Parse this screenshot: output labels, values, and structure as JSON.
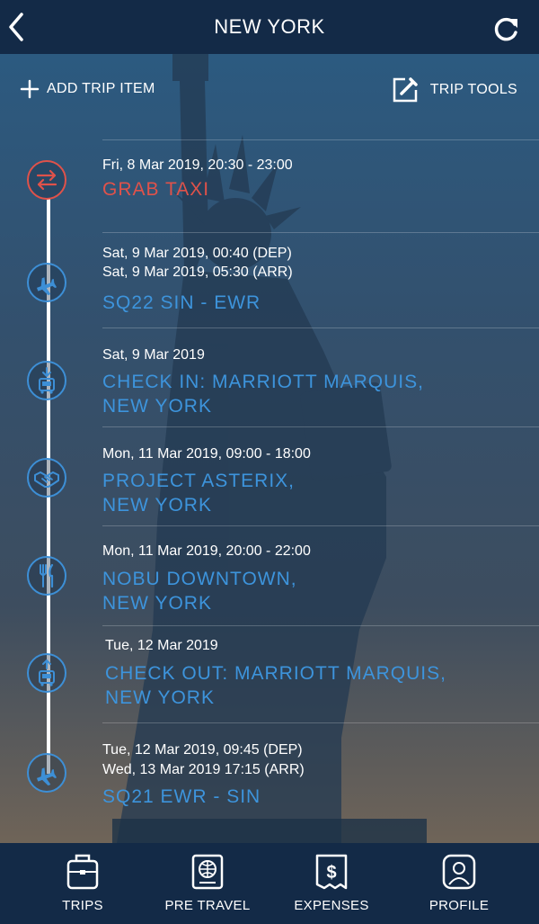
{
  "header": {
    "title": "NEW YORK"
  },
  "toolbar": {
    "add_label": "ADD TRIP ITEM",
    "tools_label": "TRIP TOOLS"
  },
  "items": [
    {
      "when1": "Fri, 8 Mar 2019, 20:30  - 23:00",
      "title1": "GRAB TAXI",
      "icon": "transfer-icon"
    },
    {
      "when1": "Sat, 9 Mar 2019, 00:40 (DEP)",
      "when2": "Sat, 9 Mar 2019, 05:30 (ARR)",
      "title1": "SQ22 SIN - EWR",
      "icon": "airplane-icon"
    },
    {
      "when1": "Sat, 9 Mar 2019",
      "title1": "CHECK IN: MARRIOTT MARQUIS,",
      "title2": "NEW YORK",
      "icon": "hotel-check-in-icon"
    },
    {
      "when1": "Mon, 11 Mar 2019, 09:00 - 18:00",
      "title1": "PROJECT ASTERIX,",
      "title2": "NEW YORK",
      "icon": "handshake-icon"
    },
    {
      "when1": "Mon, 11 Mar 2019, 20:00  - 22:00",
      "title1": "NOBU DOWNTOWN,",
      "title2": "NEW YORK",
      "icon": "fork-knife-icon"
    },
    {
      "when1": "Tue, 12 Mar 2019",
      "title1": "CHECK OUT: MARRIOTT MARQUIS,",
      "title2": "NEW YORK",
      "icon": "hotel-check-out-icon"
    },
    {
      "when1": "Tue, 12 Mar 2019, 09:45 (DEP)",
      "when2": "Wed, 13 Mar 2019 17:15 (ARR)",
      "title1": "SQ21 EWR - SIN",
      "icon": "airplane-icon"
    }
  ],
  "nav": [
    {
      "label": "TRIPS",
      "icon": "luggage-icon"
    },
    {
      "label": "PRE TRAVEL",
      "icon": "passport-icon"
    },
    {
      "label": "EXPENSES",
      "icon": "receipt-dollar-icon"
    },
    {
      "label": "PROFILE",
      "icon": "profile-icon"
    }
  ],
  "colors": {
    "header_bg": "#132a47",
    "accent_blue": "#3d94dc",
    "accent_red": "#e0524a"
  }
}
